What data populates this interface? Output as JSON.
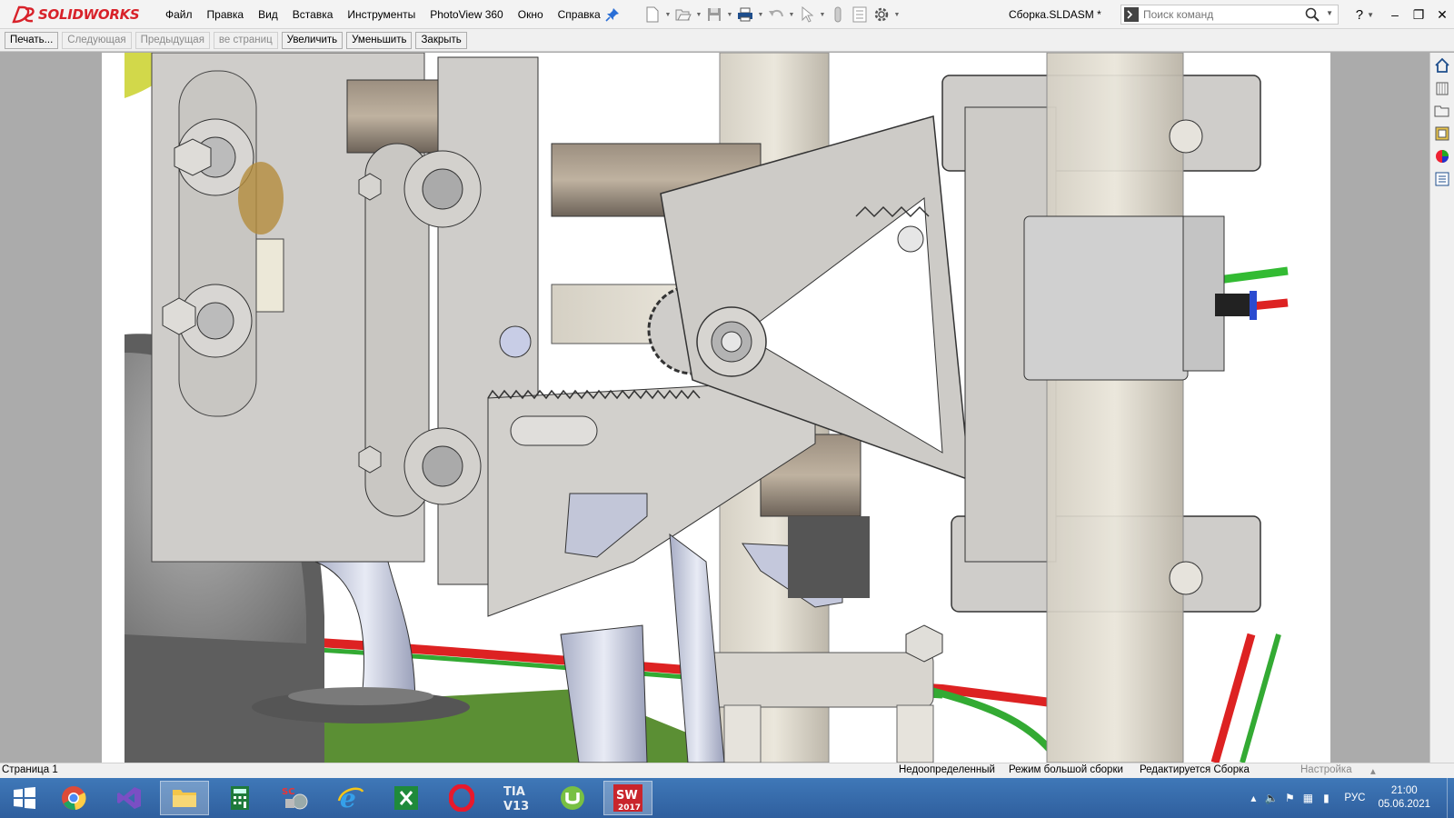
{
  "app": {
    "brand_prefix": "SOLID",
    "brand_suffix": "WORKS",
    "document_title": "Сборка.SLDASM *",
    "brand_color": "#d8222a"
  },
  "menu": {
    "items": [
      "Файл",
      "Правка",
      "Вид",
      "Вставка",
      "Инструменты",
      "PhotoView 360",
      "Окно",
      "Справка"
    ]
  },
  "quick_access": {
    "icons": [
      "new-document-icon",
      "open-folder-icon",
      "save-icon",
      "print-icon",
      "undo-icon",
      "select-cursor-icon",
      "rebuild-icon",
      "file-properties-icon",
      "options-gear-icon"
    ]
  },
  "command_search": {
    "placeholder": "Поиск команд"
  },
  "window_controls": {
    "help": "?",
    "minimize": "–",
    "restore": "❐",
    "close": "✕"
  },
  "print_preview": {
    "buttons": [
      {
        "label": "Печать...",
        "enabled": true
      },
      {
        "label": "Следующая",
        "enabled": false
      },
      {
        "label": "Предыдущая",
        "enabled": false
      },
      {
        "label": "ве страниц",
        "enabled": false
      },
      {
        "label": "Увеличить",
        "enabled": true
      },
      {
        "label": "Уменьшить",
        "enabled": true
      },
      {
        "label": "Закрыть",
        "enabled": true
      }
    ]
  },
  "task_pane": {
    "icons": [
      "home-icon",
      "design-library-icon",
      "file-explorer-icon",
      "view-palette-icon",
      "appearances-icon",
      "custom-properties-icon"
    ]
  },
  "status_bar": {
    "page": "Страница 1",
    "definition": "Недоопределенный",
    "mode": "Режим большой сборки",
    "editing": "Редактируется Сборка",
    "settings": "Настройка",
    "arrow": "▴"
  },
  "taskbar": {
    "apps": [
      "windows-start-icon",
      "chrome-icon",
      "visual-studio-icon",
      "file-explorer-icon",
      "calculator-icon",
      "step7-icon",
      "internet-explorer-icon",
      "excel-icon",
      "opera-icon",
      "tia-portal-icon",
      "utorrent-icon",
      "solidworks-2017-icon"
    ],
    "tia_label_top": "TIA",
    "tia_label_bottom": "V13",
    "sw_label": "2017",
    "lang": "РУС",
    "time": "21:00",
    "date": "05.06.2021"
  }
}
